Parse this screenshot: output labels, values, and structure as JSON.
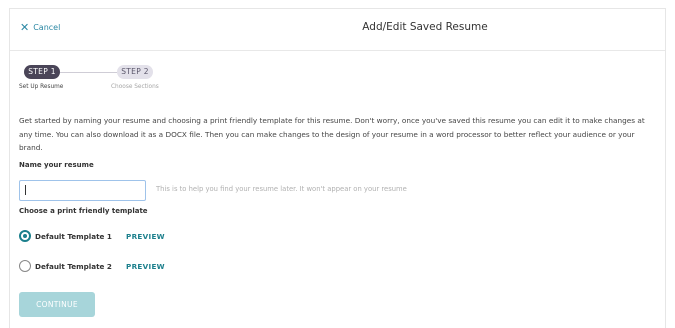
{
  "header": {
    "cancel_label": "Cancel",
    "title": "Add/Edit Saved Resume"
  },
  "stepper": {
    "steps": [
      {
        "label": "STEP 1",
        "caption": "Set Up Resume",
        "active": true
      },
      {
        "label": "STEP 2",
        "caption": "Choose Sections",
        "active": false
      }
    ]
  },
  "intro_text": "Get started by naming your resume and choosing a print friendly template for this resume. Don't worry, once you've saved this resume you can edit it to make changes at any time. You can also download it as a DOCX file. Then you can make changes to the design of your resume in a word processor to better reflect your audience or your brand.",
  "name_section": {
    "label": "Name your resume",
    "input_value": "",
    "helper": "This is to help you find your resume later. It won't appear on your resume"
  },
  "template_section": {
    "label": "Choose a print friendly template",
    "templates": [
      {
        "name": "Default Template 1",
        "preview_label": "PREVIEW",
        "selected": true
      },
      {
        "name": "Default Template 2",
        "preview_label": "PREVIEW",
        "selected": false
      }
    ]
  },
  "continue_label": "CONTINUE",
  "colors": {
    "accent": "#1b7f8c",
    "link": "#2a87a3",
    "step_active": "#4a4558",
    "step_inactive": "#e3e1ea",
    "button_disabled": "#a7d5da"
  },
  "icons": {
    "cancel": "close-icon"
  }
}
